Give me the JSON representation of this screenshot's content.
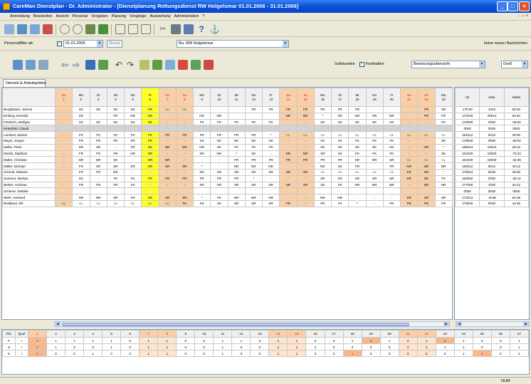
{
  "title": "CareMan Dienstplan - Dr. Administrator - [Dienstplanung  Rettungsdienst RW Holgelsmar   01.01.2006 - 31.01.2006]",
  "window_buttons": [
    "_",
    "□",
    "×"
  ],
  "menu": [
    "Anmeldung",
    "Bearbeiten",
    "Ansicht",
    "Personal",
    "Vorgaben",
    "Planung",
    "Vorgänge",
    "Auswertung",
    "Administration",
    "?"
  ],
  "mdi_controls": "- ♂ ×",
  "filter": {
    "personalfilter_label": "Personalfilter ab:",
    "date": "01.01.2006",
    "unit": "Monat",
    "org_unit": "Ru. RW Holgelsmar",
    "message": "keine neuen Nachrichten"
  },
  "toolbar3": {
    "sollstunden_label": "Sollstunden",
    "festhalten_label": "Festhalten",
    "besetzung_value": "Besetzungsübersicht",
    "gross_value": "Groß"
  },
  "tab_label": "Dienste & Arbeitsplätze",
  "days": [
    {
      "wd": "So",
      "d": "1",
      "we": true
    },
    {
      "wd": "Mo",
      "d": "2"
    },
    {
      "wd": "Di",
      "d": "3"
    },
    {
      "wd": "Mi",
      "d": "4"
    },
    {
      "wd": "Do",
      "d": "5"
    },
    {
      "wd": "Fr",
      "d": "6",
      "hl": true
    },
    {
      "wd": "Sa",
      "d": "7",
      "we": true
    },
    {
      "wd": "So",
      "d": "8",
      "we": true
    },
    {
      "wd": "Mo",
      "d": "9"
    },
    {
      "wd": "Di",
      "d": "10"
    },
    {
      "wd": "Mi",
      "d": "11"
    },
    {
      "wd": "Do",
      "d": "12"
    },
    {
      "wd": "Fr",
      "d": "13"
    },
    {
      "wd": "Sa",
      "d": "14",
      "we": true
    },
    {
      "wd": "So",
      "d": "15",
      "we": true
    },
    {
      "wd": "Mo",
      "d": "16"
    },
    {
      "wd": "Di",
      "d": "17"
    },
    {
      "wd": "Mi",
      "d": "18"
    },
    {
      "wd": "Do",
      "d": "19"
    },
    {
      "wd": "Fr",
      "d": "20"
    },
    {
      "wd": "Sa",
      "d": "21",
      "we": true
    },
    {
      "wd": "So",
      "d": "22",
      "we": true
    },
    {
      "wd": "Mo",
      "d": "23"
    }
  ],
  "employees": [
    {
      "name": "Bergbäcker, Jasmin",
      "s": [
        "-",
        "SK",
        "SK",
        "SK",
        "SK",
        "FR",
        "UL",
        "UL",
        "",
        "",
        "",
        "FR",
        "FR",
        "FR",
        "FR",
        "FR",
        "FR",
        "FR",
        "",
        "",
        "",
        "FR",
        "SR"
      ],
      "r": [
        "17h:00",
        "1h24",
        "60:00"
      ]
    },
    {
      "name": "Einfang, Dominik",
      "s": [
        "-",
        "SR",
        "-",
        "FR",
        "NR",
        "NR",
        "",
        "",
        "NR",
        "NR",
        "",
        "",
        "",
        "NR",
        "NR",
        "*",
        "SR",
        "NR",
        "SR",
        "NR",
        "",
        "FR",
        "FR"
      ],
      "r": [
        "147h40",
        "29h12",
        "63:40"
      ]
    },
    {
      "name": "Friedrich, Wolfgan",
      "s": [
        "-",
        "SK",
        "SK",
        "SK",
        "SK",
        "SK",
        "-",
        "-",
        "FK",
        "FK",
        "FK",
        "FK",
        "FK",
        "-",
        "-",
        "SK",
        "SK",
        "SK",
        "SK",
        "SK",
        "-",
        "-",
        "FK"
      ],
      "r": [
        "178h00",
        "0h00",
        "-28:00"
      ]
    },
    {
      "name": "Hinterfeld, Claudi",
      "s": [],
      "gray": true,
      "r": [
        "0h00",
        "0h00",
        "0h00"
      ]
    },
    {
      "name": "Lambert, Marion",
      "s": [
        "-",
        "FK",
        "FK",
        "FK",
        "FK",
        "FK",
        "FR",
        "FR",
        "FR",
        "FR",
        "FR",
        "FR",
        "*",
        "UL",
        "UL",
        "UL",
        "UL",
        "UL",
        "UL",
        "UL",
        "UL",
        "UL",
        "UL"
      ],
      "r": [
        "181h12",
        "5h12",
        "28:00"
      ]
    },
    {
      "name": "Mayer, Jürgen",
      "s": [
        "-",
        "FR",
        "FR",
        "FR",
        "FR",
        "FR",
        "-",
        "-",
        "SK",
        "SK",
        "SK",
        "SK",
        "SK",
        "-",
        "-",
        "FK",
        "FK",
        "FK",
        "FK",
        "FK",
        "-",
        "-",
        "SK"
      ],
      "r": [
        "178h00",
        "0h00",
        "-28:00"
      ]
    },
    {
      "name": "Moller, Peter",
      "s": [
        "-",
        "SR",
        "SR",
        "-",
        "FR",
        "SK",
        "NR",
        "NR",
        "NR",
        "SK",
        "FK",
        "FK",
        "FK",
        "-",
        "-",
        "SK",
        "SK",
        "SK",
        "SK",
        "SK",
        "-",
        "NR",
        "*"
      ],
      "r": [
        "188h24",
        "10h24",
        "28:12"
      ]
    },
    {
      "name": "Moslin, Matthias",
      "s": [
        "-",
        "FR",
        "FR",
        "FR",
        "NR",
        "NR",
        "-",
        "-",
        "SR",
        "NR",
        "*",
        "SK",
        "-",
        "NR",
        "NR",
        "SR",
        "SK",
        "FK",
        "FK",
        "FK",
        "-",
        "-",
        "SK"
      ],
      "r": [
        "161h00",
        "15h00",
        "-70:24"
      ]
    },
    {
      "name": "Muller, Christian",
      "s": [
        "-",
        "NR",
        "NR",
        "SK",
        "-",
        "NR",
        "NR",
        "-",
        "-",
        "-",
        "FR",
        "FR",
        "FR",
        "FR",
        "FR",
        "FR",
        "FR",
        "SR",
        "NR",
        "SR",
        "UL",
        "UL",
        "UL"
      ],
      "r": [
        "161h00",
        "15h00",
        "-42:48"
      ]
    },
    {
      "name": "Müller, Michael",
      "s": [
        "-",
        "FR",
        "SR",
        "SR",
        "SR",
        "SR",
        "SR",
        "SR",
        "*",
        "-",
        "NR",
        "NR",
        "NR",
        "",
        "",
        "NR",
        "SK",
        "FR",
        "",
        "FR",
        "NR",
        "NR",
        "NR"
      ],
      "r": [
        "182h12",
        "9h12",
        "49:12"
      ]
    },
    {
      "name": "Schmitt, Melanie",
      "s": [
        "-",
        "FR",
        "FR",
        "NR",
        "-",
        "-",
        "-",
        "-",
        "SR",
        "SR",
        "SR",
        "SR",
        "SR",
        "SR",
        "SR",
        "UL",
        "UL",
        "UL",
        "UL",
        "UL",
        "FR",
        "SR",
        "*"
      ],
      "r": [
        "178h24",
        "5h36",
        "28:00"
      ]
    },
    {
      "name": "Sommer, Markus",
      "s": [
        "-",
        "SK",
        "-",
        "FK",
        "FK",
        "FR",
        "FR",
        "FR",
        "FR",
        "FR",
        "FR",
        "*",
        "-",
        "-",
        "-",
        "SR",
        "SR",
        "SR",
        "SR",
        "SR",
        "SR",
        "SK",
        "FK"
      ],
      "r": [
        "165h00",
        "0h00",
        "-49:12"
      ]
    },
    {
      "name": "Weber, Andreas",
      "s": [
        "-",
        "FR",
        "FR",
        "FR",
        "FK",
        "-",
        "-",
        "-",
        "SR",
        "SR",
        "SR",
        "SR",
        "SR",
        "SR",
        "SR",
        "SK",
        "FK",
        "NR",
        "NR",
        "NR",
        "-",
        "SR",
        "NR"
      ],
      "r": [
        "177h00",
        "1h00",
        "34:12"
      ]
    },
    {
      "name": "Schierer, Wiebke",
      "s": [],
      "r": [
        "0h00",
        "0h00",
        "0h00"
      ]
    },
    {
      "name": "Wirth, Gerhard",
      "s": [
        "-",
        "NR",
        "NR",
        "SR",
        "SR",
        "SR",
        "SR",
        "SR",
        "*",
        "FK",
        "NR",
        "NR",
        "NR",
        "-",
        "-",
        "NR",
        "NR",
        "-",
        "-",
        "-",
        "SR",
        "SR",
        "SR"
      ],
      "r": [
        "174h12",
        "-1h48",
        "60:36"
      ]
    },
    {
      "name": "Woldkind, Elli",
      "s": [
        "UL",
        "UL",
        "UL",
        "UL",
        "UL",
        "UL",
        "UL",
        "FK",
        "SK",
        "SK",
        "SR",
        "SR",
        "SR",
        "FR",
        "-",
        "FR",
        "FK",
        "*",
        "-",
        "FR",
        "FR",
        "FR",
        "FR"
      ],
      "r": [
        "178h00",
        "0h00",
        "43:48"
      ]
    }
  ],
  "right_headers": [
    "Ist",
    "Abw.",
    "Saldo"
  ],
  "summary": {
    "head": [
      "Fkt.",
      "Quel"
    ],
    "days": [
      "1",
      "2",
      "3",
      "4",
      "5",
      "6",
      "7",
      "8",
      "9",
      "10",
      "11",
      "12",
      "13",
      "14",
      "15",
      "16",
      "17",
      "18",
      "19",
      "20",
      "21",
      "22",
      "23",
      "24",
      "25",
      "26",
      "27"
    ],
    "rows": [
      {
        "f": "F",
        "q": "+",
        "v": [
          "2",
          "1",
          "1",
          "1",
          "1",
          "0",
          "1",
          "1",
          "0",
          "0",
          "1",
          "1",
          "0",
          "1",
          "1",
          "0",
          "0",
          "1",
          "3",
          "1",
          "0",
          "1",
          "3",
          "1",
          "0",
          "0",
          "1"
        ]
      },
      {
        "f": "S",
        "q": "+",
        "v": [
          "2",
          "1",
          "0",
          "0",
          "1",
          "0",
          "1",
          "1",
          "0",
          "0",
          "1",
          "0",
          "0",
          "1",
          "1",
          "2",
          "0",
          "0",
          "0",
          "0",
          "2",
          "1",
          "1",
          "1",
          "0",
          "0",
          "1"
        ]
      },
      {
        "f": "K",
        "q": "+",
        "v": [
          "2",
          "0",
          "0",
          "1",
          "0",
          "0",
          "1",
          "1",
          "0",
          "0",
          "1",
          "0",
          "0",
          "1",
          "1",
          "0",
          "0",
          "1",
          "0",
          "0",
          "0",
          "0",
          "0",
          "1",
          "4",
          "0",
          "2"
        ]
      }
    ]
  },
  "status_text": "NUM",
  "icons": [
    "open-icon",
    "print-icon",
    "filter-icon",
    "undo-icon",
    "redo-icon",
    "calculator-icon",
    "help-icon"
  ]
}
